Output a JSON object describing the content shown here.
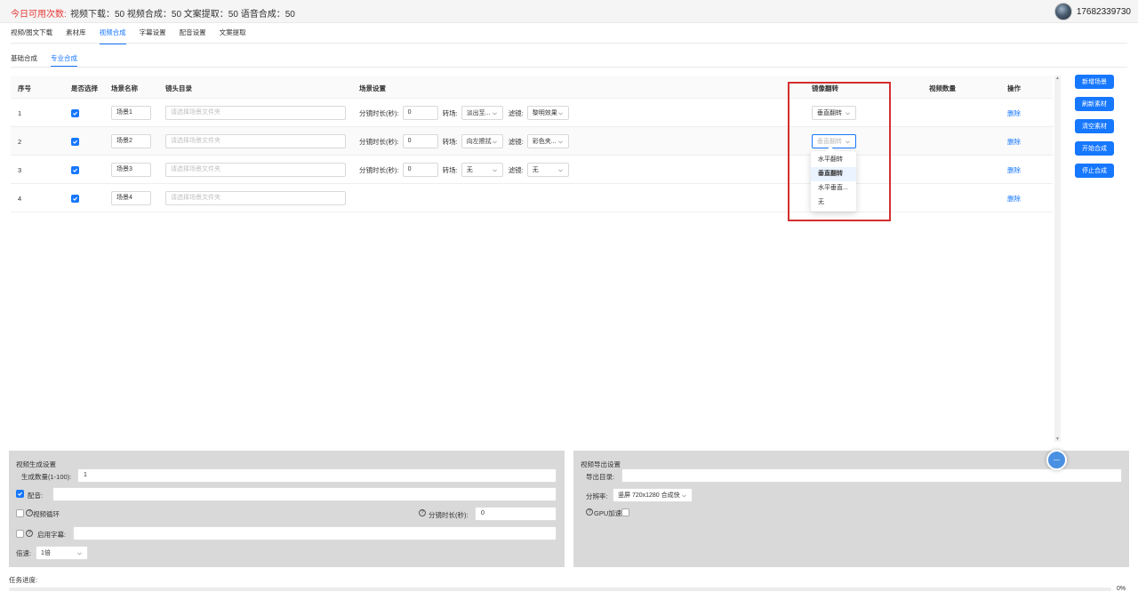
{
  "header": {
    "quota_label": "今日可用次数:",
    "quota_stats": "视频下载：50  视频合成：50  文案提取：50  语音合成：50",
    "user_name": "17682339730"
  },
  "main_tabs": [
    "视频/图文下载",
    "素材库",
    "视频合成",
    "字幕设置",
    "配音设置",
    "文案提取"
  ],
  "main_tab_active": "视频合成",
  "sub_tabs": [
    "基础合成",
    "专业合成"
  ],
  "sub_tab_active": "专业合成",
  "table": {
    "headers": {
      "index": "序号",
      "selected": "是否选择",
      "scene_name": "场景名称",
      "shot_dir": "镜头目录",
      "scene_settings": "场景设置",
      "mirror_flip": "镜像翻转",
      "video_count": "视频数量",
      "actions": "操作"
    },
    "shot_dir_placeholder": "请选择场景文件夹",
    "labels": {
      "duration": "分镜时长(秒):",
      "transition": "转场:",
      "filter": "滤镜:"
    },
    "delete_label": "删除",
    "rows": [
      {
        "index": "1",
        "scene_name": "场景1",
        "duration": "0",
        "transition": "淡出至...",
        "filter": "黎明效果",
        "mirror": "垂直翻转"
      },
      {
        "index": "2",
        "scene_name": "场景2",
        "duration": "0",
        "transition": "向左擦拭",
        "filter": "彩色夹...",
        "mirror": "垂直翻转"
      },
      {
        "index": "3",
        "scene_name": "场景3",
        "duration": "0",
        "transition": "无",
        "filter": "无",
        "mirror": ""
      },
      {
        "index": "4",
        "scene_name": "场景4",
        "duration": "",
        "transition": "",
        "filter": "",
        "mirror": ""
      }
    ]
  },
  "mirror_dropdown": {
    "options": [
      "水平翻转",
      "垂直翻转",
      "水平垂直...",
      "无"
    ],
    "selected": "垂直翻转"
  },
  "right_buttons": [
    "新增场景",
    "刷新素材",
    "清空素材",
    "开始合成",
    "停止合成"
  ],
  "gen_settings": {
    "title": "视频生成设置",
    "count_label": "生成数量(1-100):",
    "count_value": "1",
    "dubbing_label": "配音:",
    "dubbing_checked": true,
    "loop_label": "视频循环",
    "loop_checked": false,
    "shot_duration_label": "分镜时长(秒):",
    "shot_duration_value": "0",
    "subtitle_label": "启用字幕:",
    "subtitle_checked": false,
    "speed_label": "倍速:",
    "speed_value": "1倍"
  },
  "export_settings": {
    "title": "视频导出设置",
    "dir_label": "导出目录:",
    "resolution_label": "分辨率:",
    "resolution_value": "竖屏 720x1280 合成快",
    "gpu_label": "GPU加速:",
    "gpu_checked": false
  },
  "progress": {
    "label": "任务进度:",
    "percent_text": "0%",
    "value": 0
  },
  "colors": {
    "accent": "#1677ff",
    "quota_red": "#e53935",
    "highlight_red": "#d32f2f"
  }
}
